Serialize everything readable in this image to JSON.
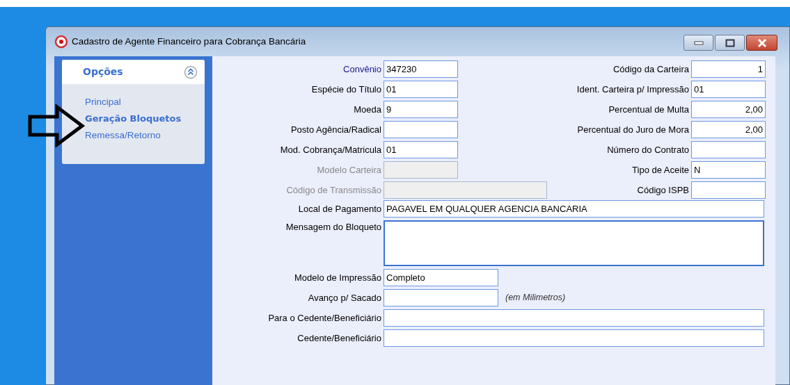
{
  "window": {
    "title": "Cadastro de Agente Financeiro para Cobrança Bancária"
  },
  "sidebar": {
    "title": "Opções",
    "items": [
      {
        "label": "Principal",
        "selected": false
      },
      {
        "label": "Geração Bloquetos",
        "selected": true
      },
      {
        "label": "Remessa/Retorno",
        "selected": false
      }
    ]
  },
  "left_fields": [
    {
      "kind": "text",
      "label": "Convênio",
      "value": "347230",
      "focused": true,
      "disabled": false
    },
    {
      "kind": "text",
      "label": "Espécie do Título",
      "value": "01",
      "focused": false,
      "disabled": false
    },
    {
      "kind": "text",
      "label": "Moeda",
      "value": "9",
      "focused": false,
      "disabled": false
    },
    {
      "kind": "text",
      "label": "Posto Agência/Radical",
      "focused": false,
      "disabled": false
    },
    {
      "kind": "text",
      "label": "Mod. Cobrança/Matricula",
      "value": "01",
      "focused": false,
      "disabled": false
    },
    {
      "kind": "text",
      "label": "Modelo Carteira",
      "focused": false,
      "disabled": true
    },
    {
      "kind": "wide",
      "label": "Código de Transmissão",
      "focused": false,
      "disabled": true
    }
  ],
  "right_fields": [
    {
      "kind": "number",
      "label": "Código da Carteira",
      "value": "1",
      "focused": false,
      "disabled": false
    },
    {
      "kind": "text",
      "label": "Ident. Carteira p/ Impressão",
      "value": "01",
      "focused": false,
      "disabled": false
    },
    {
      "kind": "number",
      "label": "Percentual de Multa",
      "value": "2,00",
      "focused": false,
      "disabled": false
    },
    {
      "kind": "number",
      "label": "Percentual do Juro de Mora",
      "value": "2,00",
      "focused": false,
      "disabled": false
    },
    {
      "kind": "text",
      "label": "Número do Contrato",
      "focused": false,
      "disabled": false
    },
    {
      "kind": "text",
      "label": "Tipo de Aceite",
      "value": "N",
      "focused": false,
      "disabled": false
    },
    {
      "kind": "text",
      "label": "Código ISPB",
      "focused": false,
      "disabled": false
    }
  ],
  "bottom_fields": [
    {
      "kind": "line",
      "label": "Local de Pagamento",
      "value": "PAGAVEL EM QUALQUER AGENCIA BANCARIA"
    },
    {
      "kind": "memo",
      "label": "Mensagem do Bloqueto"
    },
    {
      "kind": "short",
      "label": "Modelo de Impressão",
      "value": "Completo"
    },
    {
      "kind": "short",
      "label": "Avanço p/ Sacado",
      "note": "(em Milimetros)"
    },
    {
      "kind": "line",
      "label": "Para o Cedente/Beneficiário"
    },
    {
      "kind": "line",
      "label": "Cedente/Beneficiário"
    }
  ]
}
